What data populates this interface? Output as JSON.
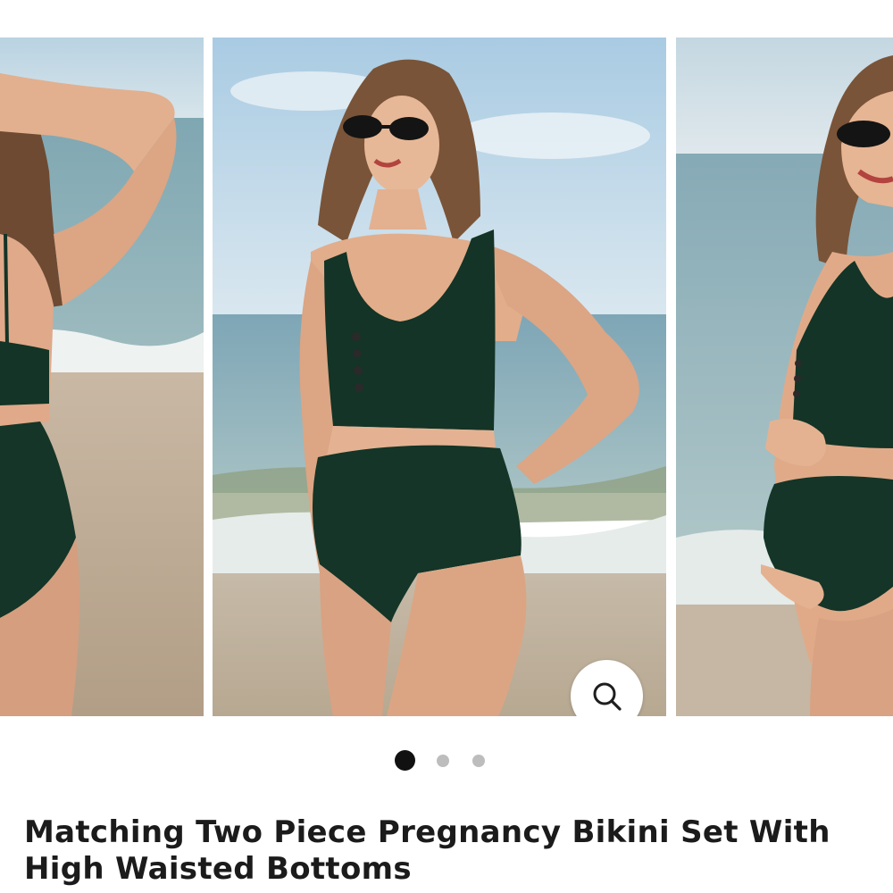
{
  "product": {
    "title": "Matching Two Piece Pregnancy Bikini Set With High Waisted Bottoms"
  },
  "gallery": {
    "image_count": 3,
    "active_index": 0,
    "zoom_icon": "magnifier-icon"
  },
  "colors": {
    "swimsuit_green": "#133426",
    "active_dot": "#111111",
    "inactive_dot": "#bdbdbd",
    "title_text": "#1b1b1b"
  }
}
